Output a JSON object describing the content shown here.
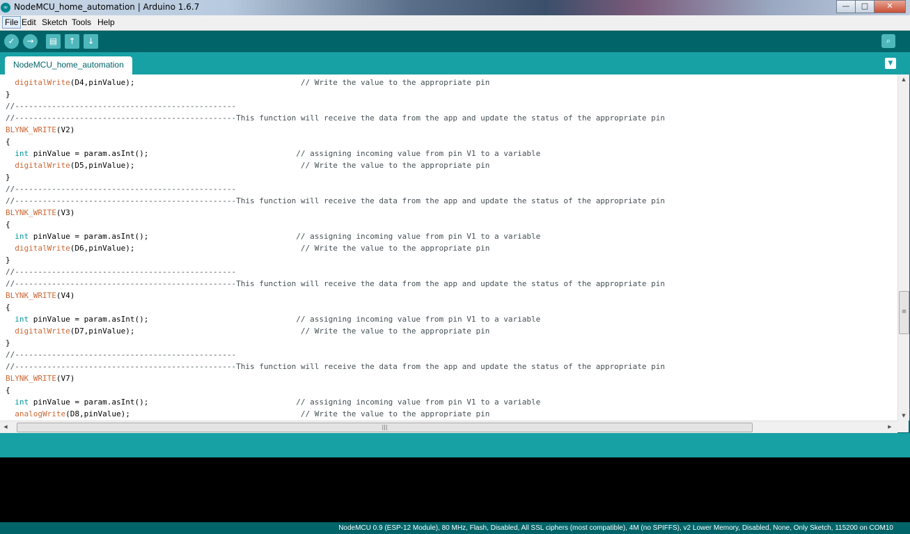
{
  "window": {
    "title": "NodeMCU_home_automation | Arduino 1.6.7",
    "app_icon": "arduino-logo",
    "app_icon_glyph": "∞",
    "buttons": {
      "minimize": "—",
      "maximize": "□",
      "close": "✕"
    }
  },
  "menu": [
    "File",
    "Edit",
    "Sketch",
    "Tools",
    "Help"
  ],
  "toolbar": {
    "verify_icon": "✓",
    "upload_icon": "→",
    "new_icon": "▤",
    "open_icon": "↑",
    "save_icon": "↓",
    "serial_monitor_icon": "⌕"
  },
  "tab": {
    "label": "NodeMCU_home_automation",
    "menu_icon": "▼"
  },
  "code_lines": [
    {
      "ind": "  ",
      "kw": "digitalWrite",
      "rest": "(D4,pinValue);                                    ",
      "cm": "// Write the value to the appropriate pin"
    },
    {
      "ind": "",
      "kw": "",
      "rest": "}",
      "cm": ""
    },
    {
      "ind": "",
      "kw": "",
      "rest": "",
      "cm": "//------------------------------------------------"
    },
    {
      "ind": "",
      "kw": "",
      "rest": "",
      "cm": "//------------------------------------------------This function will receive the data from the app and update the status of the appropriate pin"
    },
    {
      "ind": "",
      "kw": "BLYNK_WRITE",
      "rest": "(V2)",
      "cm": ""
    },
    {
      "ind": "",
      "kw": "",
      "rest": "{",
      "cm": ""
    },
    {
      "ind": "  ",
      "type": "int",
      "rest": " pinValue = param.asInt();                                ",
      "cm": "// assigning incoming value from pin V1 to a variable"
    },
    {
      "ind": "  ",
      "kw": "digitalWrite",
      "rest": "(D5,pinValue);                                    ",
      "cm": "// Write the value to the appropriate pin"
    },
    {
      "ind": "",
      "kw": "",
      "rest": "}",
      "cm": ""
    },
    {
      "ind": "",
      "kw": "",
      "rest": "",
      "cm": "//------------------------------------------------"
    },
    {
      "ind": "",
      "kw": "",
      "rest": "",
      "cm": "//------------------------------------------------This function will receive the data from the app and update the status of the appropriate pin"
    },
    {
      "ind": "",
      "kw": "BLYNK_WRITE",
      "rest": "(V3)",
      "cm": ""
    },
    {
      "ind": "",
      "kw": "",
      "rest": "{",
      "cm": ""
    },
    {
      "ind": "  ",
      "type": "int",
      "rest": " pinValue = param.asInt();                                ",
      "cm": "// assigning incoming value from pin V1 to a variable"
    },
    {
      "ind": "  ",
      "kw": "digitalWrite",
      "rest": "(D6,pinValue);                                    ",
      "cm": "// Write the value to the appropriate pin"
    },
    {
      "ind": "",
      "kw": "",
      "rest": "}",
      "cm": ""
    },
    {
      "ind": "",
      "kw": "",
      "rest": "",
      "cm": "//------------------------------------------------"
    },
    {
      "ind": "",
      "kw": "",
      "rest": "",
      "cm": "//------------------------------------------------This function will receive the data from the app and update the status of the appropriate pin"
    },
    {
      "ind": "",
      "kw": "BLYNK_WRITE",
      "rest": "(V4)",
      "cm": ""
    },
    {
      "ind": "",
      "kw": "",
      "rest": "{",
      "cm": ""
    },
    {
      "ind": "  ",
      "type": "int",
      "rest": " pinValue = param.asInt();                                ",
      "cm": "// assigning incoming value from pin V1 to a variable"
    },
    {
      "ind": "  ",
      "kw": "digitalWrite",
      "rest": "(D7,pinValue);                                    ",
      "cm": "// Write the value to the appropriate pin"
    },
    {
      "ind": "",
      "kw": "",
      "rest": "}",
      "cm": ""
    },
    {
      "ind": "",
      "kw": "",
      "rest": "",
      "cm": "//------------------------------------------------"
    },
    {
      "ind": "",
      "kw": "",
      "rest": "",
      "cm": "//------------------------------------------------This function will receive the data from the app and update the status of the appropriate pin"
    },
    {
      "ind": "",
      "kw": "BLYNK_WRITE",
      "rest": "(V7)",
      "cm": ""
    },
    {
      "ind": "",
      "kw": "",
      "rest": "{",
      "cm": ""
    },
    {
      "ind": "  ",
      "type": "int",
      "rest": " pinValue = param.asInt();                                ",
      "cm": "// assigning incoming value from pin V1 to a variable"
    },
    {
      "ind": "  ",
      "kw": "analogWrite",
      "rest": "(D8,pinValue);                                     ",
      "cm": "// Write the value to the appropriate pin"
    }
  ],
  "scrollbars": {
    "vertical_up": "▲",
    "vertical_down": "▼",
    "vertical_grip": "≡",
    "horizontal_left": "◀",
    "horizontal_right": "▶",
    "horizontal_grip": "|||"
  },
  "status": {
    "board_info": "NodeMCU 0.9 (ESP-12 Module), 80 MHz, Flash, Disabled, All SSL ciphers (most compatible), 4M (no SPIFFS), v2 Lower Memory, Disabled, None, Only Sketch, 115200 on COM10"
  },
  "colors": {
    "teal_dark": "#006468",
    "teal_light": "#17a1a5",
    "keyword": "#cc6633",
    "type": "#00979c",
    "comment": "#434f54"
  }
}
